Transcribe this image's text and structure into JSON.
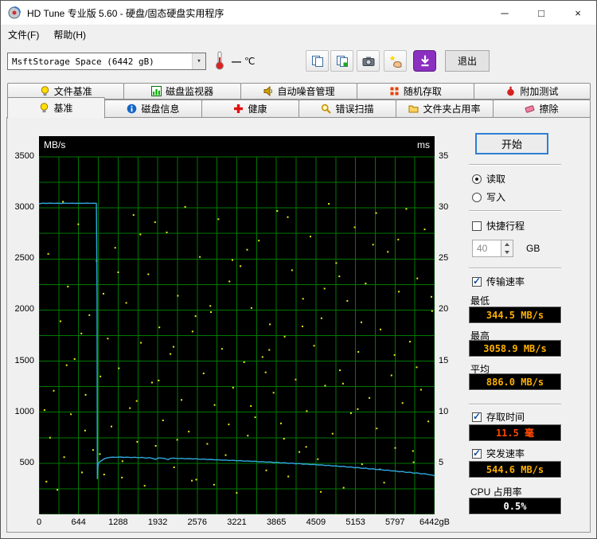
{
  "window": {
    "title": "HD Tune 专业版 5.60 - 硬盘/固态硬盘实用程序",
    "controls": {
      "minimize": "─",
      "maximize": "□",
      "close": "×"
    }
  },
  "menu": {
    "items": [
      {
        "label": "文件(F)"
      },
      {
        "label": "帮助(H)"
      }
    ]
  },
  "toolbar": {
    "device_select": {
      "value": "MsftStorage Space (6442 gB)",
      "arrow": "▾"
    },
    "temperature": {
      "value": "—",
      "unit": "℃"
    },
    "exit_label": "退出"
  },
  "tabs_row1": [
    {
      "label": "文件基准",
      "icon": "lamp-icon"
    },
    {
      "label": "磁盘监视器",
      "icon": "monitor-icon"
    },
    {
      "label": "自动噪音管理",
      "icon": "speaker-icon"
    },
    {
      "label": "随机存取",
      "icon": "random-access-icon"
    },
    {
      "label": "附加测试",
      "icon": "extra-tests-icon"
    }
  ],
  "tabs_row2": [
    {
      "label": "基准",
      "icon": "lamp-icon",
      "active": true
    },
    {
      "label": "磁盘信息",
      "icon": "info-icon"
    },
    {
      "label": "健康",
      "icon": "health-icon"
    },
    {
      "label": "错误扫描",
      "icon": "scan-icon"
    },
    {
      "label": "文件夹占用率",
      "icon": "folder-icon"
    },
    {
      "label": "擦除",
      "icon": "eraser-icon"
    }
  ],
  "panel": {
    "start_button": "开始",
    "read_label": "读取",
    "read_checked": true,
    "write_label": "写入",
    "write_checked": false,
    "short_stroke": {
      "label": "快捷行程",
      "checked": false,
      "value": "40",
      "unit": "GB"
    },
    "transfer_rate": {
      "label": "传输速率",
      "checked": true,
      "min_label": "最低",
      "min_value": "344.5 MB/s",
      "max_label": "最高",
      "max_value": "3058.9 MB/s",
      "avg_label": "平均",
      "avg_value": "886.0 MB/s"
    },
    "access_time": {
      "label": "存取时间",
      "checked": true,
      "value": "11.5 毫"
    },
    "burst_rate": {
      "label": "突发速率",
      "checked": true,
      "value": "544.6 MB/s"
    },
    "cpu_usage": {
      "label": "CPU 占用率",
      "value": "0.5%"
    }
  },
  "colors": {
    "value_bg": "#000000",
    "value_text": "#ffb000",
    "access_value_text": "#ff4800",
    "cpu_value_text": "#ffffff",
    "accent_blue": "#2e7fd3",
    "plot_line": "#2fa8dc",
    "plot_dots": "#e8e81a",
    "grid_green": "#007800"
  },
  "chart_data": {
    "type": "line",
    "plot_bg": "#000000",
    "grid": {
      "color": "#007800",
      "x_divisions": 20,
      "y_divisions": 14
    },
    "x": {
      "min": 0,
      "max": 6442,
      "unit": "gB",
      "tick_labels": [
        "0",
        "644",
        "1288",
        "1932",
        "2576",
        "3221",
        "3865",
        "4509",
        "5153",
        "5797",
        "6442gB"
      ]
    },
    "y_left": {
      "label": "MB/s",
      "min": 0,
      "max": 3500,
      "ticks": [
        500,
        1000,
        1500,
        2000,
        2500,
        3000,
        3500
      ]
    },
    "y_right": {
      "label": "ms",
      "min": 0,
      "max": 35,
      "ticks": [
        5,
        10,
        15,
        20,
        25,
        30,
        35
      ]
    },
    "series": [
      {
        "name": "传输速率",
        "style": "line",
        "axis": "left",
        "color": "#2fa8dc",
        "unit": "MB/s",
        "points": [
          [
            0,
            3040
          ],
          [
            60,
            3046
          ],
          [
            120,
            3044
          ],
          [
            180,
            3047
          ],
          [
            240,
            3045
          ],
          [
            300,
            3046
          ],
          [
            360,
            3044
          ],
          [
            420,
            3047
          ],
          [
            480,
            3045
          ],
          [
            540,
            3046
          ],
          [
            600,
            3044
          ],
          [
            660,
            3046
          ],
          [
            720,
            3045
          ],
          [
            780,
            3047
          ],
          [
            840,
            3045
          ],
          [
            900,
            3046
          ],
          [
            935,
            3044
          ],
          [
            945,
            2200
          ],
          [
            950,
            345
          ],
          [
            958,
            470
          ],
          [
            970,
            500
          ],
          [
            990,
            515
          ],
          [
            1010,
            522
          ],
          [
            1040,
            535
          ],
          [
            1080,
            548
          ],
          [
            1120,
            554
          ],
          [
            1160,
            558
          ],
          [
            1200,
            560
          ],
          [
            1260,
            558
          ],
          [
            1320,
            561
          ],
          [
            1380,
            557
          ],
          [
            1440,
            560
          ],
          [
            1500,
            556
          ],
          [
            1560,
            559
          ],
          [
            1620,
            554
          ],
          [
            1680,
            557
          ],
          [
            1740,
            550
          ],
          [
            1800,
            555
          ],
          [
            1860,
            545
          ],
          [
            1900,
            538
          ],
          [
            1940,
            552
          ],
          [
            2000,
            550
          ],
          [
            2060,
            546
          ],
          [
            2100,
            534
          ],
          [
            2140,
            548
          ],
          [
            2200,
            550
          ],
          [
            2260,
            545
          ],
          [
            2320,
            548
          ],
          [
            2380,
            543
          ],
          [
            2440,
            546
          ],
          [
            2500,
            542
          ],
          [
            2560,
            544
          ],
          [
            2620,
            539
          ],
          [
            2680,
            541
          ],
          [
            2740,
            536
          ],
          [
            2800,
            538
          ],
          [
            2860,
            533
          ],
          [
            2920,
            535
          ],
          [
            2980,
            530
          ],
          [
            3040,
            532
          ],
          [
            3100,
            527
          ],
          [
            3160,
            529
          ],
          [
            3220,
            524
          ],
          [
            3280,
            526
          ],
          [
            3340,
            521
          ],
          [
            3400,
            523
          ],
          [
            3460,
            518
          ],
          [
            3520,
            520
          ],
          [
            3580,
            514
          ],
          [
            3640,
            516
          ],
          [
            3700,
            511
          ],
          [
            3760,
            513
          ],
          [
            3820,
            507
          ],
          [
            3880,
            509
          ],
          [
            3940,
            503
          ],
          [
            4000,
            505
          ],
          [
            4060,
            499
          ],
          [
            4120,
            501
          ],
          [
            4180,
            495
          ],
          [
            4240,
            497
          ],
          [
            4300,
            491
          ],
          [
            4360,
            493
          ],
          [
            4420,
            487
          ],
          [
            4480,
            489
          ],
          [
            4540,
            483
          ],
          [
            4600,
            485
          ],
          [
            4660,
            478
          ],
          [
            4720,
            480
          ],
          [
            4780,
            473
          ],
          [
            4840,
            475
          ],
          [
            4900,
            468
          ],
          [
            4960,
            470
          ],
          [
            5020,
            462
          ],
          [
            5080,
            464
          ],
          [
            5140,
            456
          ],
          [
            5200,
            458
          ],
          [
            5260,
            450
          ],
          [
            5320,
            452
          ],
          [
            5380,
            444
          ],
          [
            5440,
            446
          ],
          [
            5500,
            438
          ],
          [
            5560,
            440
          ],
          [
            5620,
            431
          ],
          [
            5680,
            433
          ],
          [
            5740,
            424
          ],
          [
            5800,
            426
          ],
          [
            5860,
            417
          ],
          [
            5920,
            419
          ],
          [
            5980,
            410
          ],
          [
            6040,
            412
          ],
          [
            6100,
            403
          ],
          [
            6160,
            405
          ],
          [
            6220,
            396
          ],
          [
            6280,
            398
          ],
          [
            6340,
            389
          ],
          [
            6400,
            384
          ],
          [
            6442,
            378
          ]
        ]
      },
      {
        "name": "存取时间",
        "style": "scatter",
        "axis": "right",
        "color": "#e8e81a",
        "unit": "ms",
        "points": [
          [
            120,
            3.2
          ],
          [
            180,
            7.5
          ],
          [
            240,
            12.1
          ],
          [
            300,
            2.4
          ],
          [
            350,
            18.9
          ],
          [
            410,
            5.6
          ],
          [
            470,
            22.3
          ],
          [
            520,
            9.8
          ],
          [
            580,
            15.2
          ],
          [
            640,
            28.4
          ],
          [
            700,
            4.1
          ],
          [
            760,
            11.7
          ],
          [
            820,
            19.5
          ],
          [
            880,
            6.3
          ],
          [
            940,
            24.8
          ],
          [
            1000,
            13.5
          ],
          [
            1060,
            3.9
          ],
          [
            1120,
            17.2
          ],
          [
            1180,
            8.6
          ],
          [
            1240,
            26.1
          ],
          [
            1300,
            14.3
          ],
          [
            1360,
            5.2
          ],
          [
            1420,
            20.7
          ],
          [
            1480,
            10.4
          ],
          [
            1540,
            29.3
          ],
          [
            1600,
            7.1
          ],
          [
            1660,
            16.8
          ],
          [
            1720,
            2.8
          ],
          [
            1780,
            23.5
          ],
          [
            1840,
            12.9
          ],
          [
            1900,
            6.7
          ],
          [
            1960,
            18.3
          ],
          [
            2020,
            9.2
          ],
          [
            2080,
            27.6
          ],
          [
            2140,
            15.7
          ],
          [
            2200,
            4.6
          ],
          [
            2260,
            21.4
          ],
          [
            2320,
            11.2
          ],
          [
            2380,
            30.1
          ],
          [
            2440,
            8.1
          ],
          [
            2500,
            17.9
          ],
          [
            2560,
            3.4
          ],
          [
            2620,
            25.2
          ],
          [
            2680,
            13.8
          ],
          [
            2740,
            6.9
          ],
          [
            2800,
            19.8
          ],
          [
            2860,
            10.7
          ],
          [
            2920,
            28.9
          ],
          [
            2980,
            16.2
          ],
          [
            3040,
            5.8
          ],
          [
            3100,
            22.8
          ],
          [
            3160,
            12.4
          ],
          [
            3220,
            2.1
          ],
          [
            3280,
            24.3
          ],
          [
            3340,
            14.9
          ],
          [
            3400,
            7.7
          ],
          [
            3460,
            20.2
          ],
          [
            3520,
            9.5
          ],
          [
            3580,
            26.8
          ],
          [
            3640,
            15.4
          ],
          [
            3700,
            4.3
          ],
          [
            3760,
            18.6
          ],
          [
            3820,
            11.9
          ],
          [
            3880,
            29.7
          ],
          [
            3940,
            8.9
          ],
          [
            4000,
            17.4
          ],
          [
            4060,
            3.7
          ],
          [
            4120,
            23.9
          ],
          [
            4180,
            13.2
          ],
          [
            4240,
            6.1
          ],
          [
            4300,
            21.1
          ],
          [
            4360,
            10.1
          ],
          [
            4420,
            27.2
          ],
          [
            4480,
            16.5
          ],
          [
            4540,
            5.4
          ],
          [
            4600,
            19.2
          ],
          [
            4660,
            12.6
          ],
          [
            4720,
            30.4
          ],
          [
            4780,
            7.9
          ],
          [
            4840,
            24.6
          ],
          [
            4900,
            14.1
          ],
          [
            4960,
            2.6
          ],
          [
            5020,
            20.9
          ],
          [
            5080,
            9.9
          ],
          [
            5140,
            28.1
          ],
          [
            5200,
            15.9
          ],
          [
            5260,
            4.9
          ],
          [
            5320,
            22.6
          ],
          [
            5380,
            11.4
          ],
          [
            5440,
            26.4
          ],
          [
            5500,
            8.4
          ],
          [
            5560,
            18.1
          ],
          [
            5620,
            3.1
          ],
          [
            5680,
            25.7
          ],
          [
            5740,
            13.6
          ],
          [
            5800,
            6.5
          ],
          [
            5860,
            21.8
          ],
          [
            5920,
            10.9
          ],
          [
            5980,
            29.9
          ],
          [
            6040,
            16.9
          ],
          [
            6100,
            5.1
          ],
          [
            6160,
            23.1
          ],
          [
            6220,
            12.2
          ],
          [
            6280,
            27.9
          ],
          [
            6340,
            9.1
          ],
          [
            6400,
            19.9
          ],
          [
            150,
            25.5
          ],
          [
            450,
            14.6
          ],
          [
            750,
            8.2
          ],
          [
            1050,
            21.6
          ],
          [
            1350,
            3.6
          ],
          [
            1650,
            27.4
          ],
          [
            1950,
            13.1
          ],
          [
            2250,
            7.3
          ],
          [
            2550,
            19.4
          ],
          [
            2850,
            2.9
          ],
          [
            3150,
            24.9
          ],
          [
            3450,
            10.6
          ],
          [
            3750,
            16.1
          ],
          [
            4050,
            29.1
          ],
          [
            4350,
            6.6
          ],
          [
            4650,
            22.1
          ],
          [
            4950,
            12.8
          ],
          [
            5250,
            18.8
          ],
          [
            5550,
            4.4
          ],
          [
            5850,
            26.9
          ],
          [
            6150,
            14.4
          ],
          [
            90,
            10.2
          ],
          [
            390,
            30.6
          ],
          [
            690,
            17.7
          ],
          [
            990,
            5.9
          ],
          [
            1290,
            23.7
          ],
          [
            1590,
            11.1
          ],
          [
            1890,
            28.6
          ],
          [
            2190,
            16.4
          ],
          [
            2490,
            3.3
          ],
          [
            2790,
            20.4
          ],
          [
            3090,
            8.8
          ],
          [
            3390,
            25.9
          ],
          [
            3690,
            13.9
          ],
          [
            3990,
            7.4
          ],
          [
            4290,
            18.4
          ],
          [
            4590,
            2.2
          ],
          [
            4890,
            23.3
          ],
          [
            5190,
            10.3
          ],
          [
            5490,
            29.5
          ],
          [
            5790,
            15.6
          ],
          [
            6090,
            6.2
          ],
          [
            6390,
            21.3
          ]
        ]
      }
    ]
  }
}
